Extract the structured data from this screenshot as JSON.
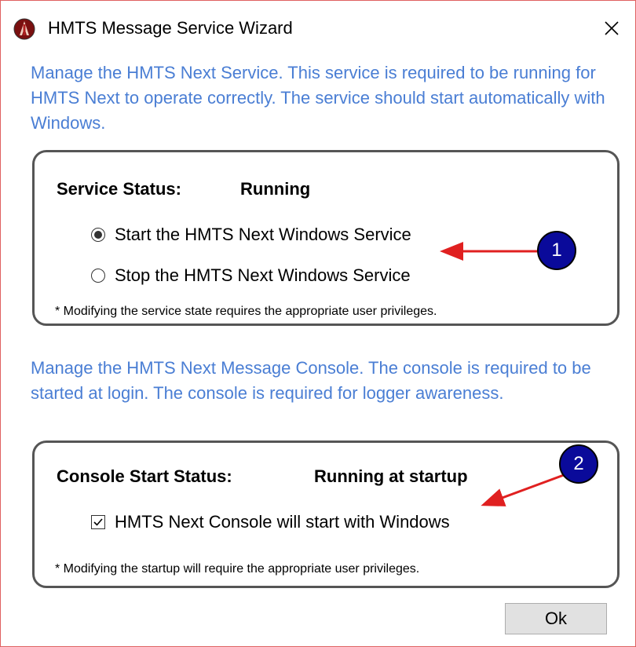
{
  "window": {
    "title": "HMTS Message Service Wizard",
    "close_glyph": "×",
    "app_icon": "hmts-logo-icon"
  },
  "service": {
    "intro": "Manage the HMTS Next Service.  This service is required to be running for HMTS Next to operate correctly.  The service should start automatically with Windows.",
    "status_label": "Service Status:",
    "status_value": "Running",
    "options": [
      {
        "label": "Start the HMTS Next Windows Service",
        "selected": true
      },
      {
        "label": "Stop the HMTS Next Windows Service",
        "selected": false
      }
    ],
    "note": "* Modifying the service state requires the appropriate user privileges."
  },
  "console": {
    "intro": "Manage the HMTS Next Message Console.  The console is required to be started at login.  The console is required for logger awareness.",
    "status_label": "Console Start Status:",
    "status_value": "Running at startup",
    "checkbox_label": "HMTS Next Console will start with Windows",
    "checkbox_checked": true,
    "note": "* Modifying the startup will require the appropriate user privileges."
  },
  "buttons": {
    "ok": "Ok"
  },
  "callouts": [
    "1",
    "2"
  ],
  "colors": {
    "intro_text": "#4a7ed4",
    "callout_fill": "#0a0a9a",
    "arrow": "#e02020",
    "window_border": "#e06060"
  }
}
